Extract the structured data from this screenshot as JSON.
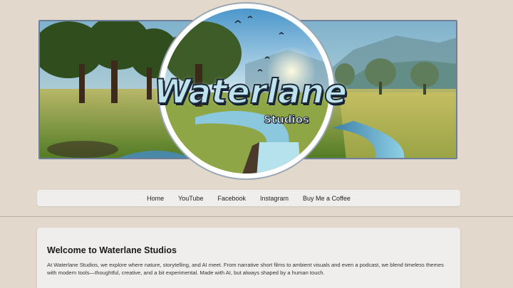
{
  "brand": {
    "logo_word": "Waterlane",
    "logo_sub": "Studios"
  },
  "nav": {
    "items": [
      "Home",
      "YouTube",
      "Facebook",
      "Instagram",
      "Buy Me a Coffee"
    ]
  },
  "welcome": {
    "title": "Welcome to Waterlane Studios",
    "body": "At Waterlane Studios, we explore where nature, storytelling, and AI meet. From narrative short films to ambient visuals and even a podcast, we blend timeless themes with modern tools—thoughtful, creative, and a bit experimental. Made with AI, but always shaped by a human touch."
  },
  "colors": {
    "page_bg": "#e2d9cc",
    "nav_bg": "#efeeec",
    "banner_border": "#6f7f99"
  }
}
